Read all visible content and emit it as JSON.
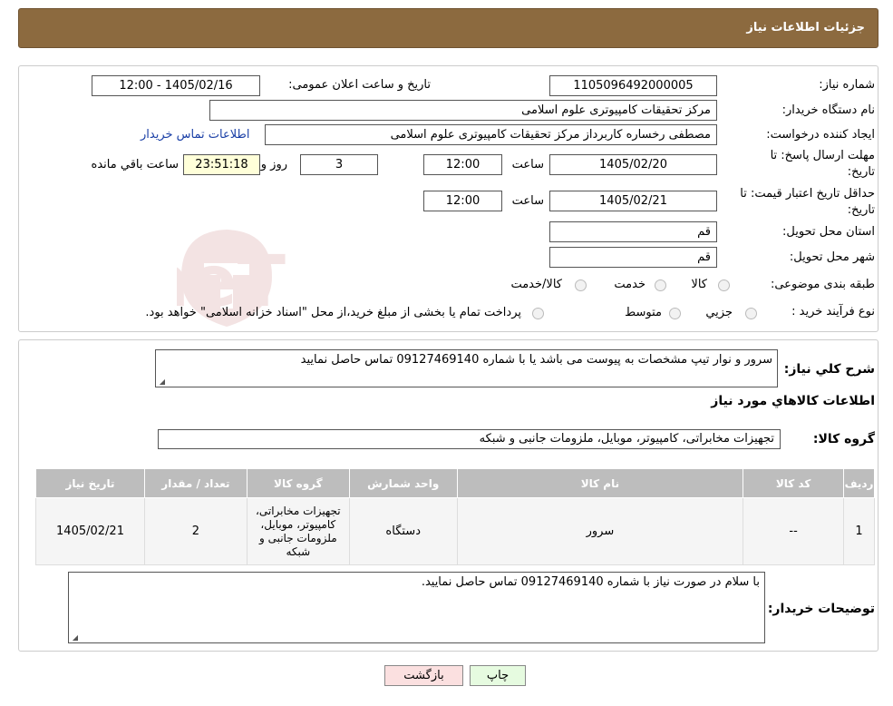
{
  "header": {
    "title": "جزئیات اطلاعات نیاز"
  },
  "fields": {
    "need_number_label": "شماره نیاز:",
    "need_number": "1105096492000005",
    "announce_label": "تاریخ و ساعت اعلان عمومی:",
    "announce_value": "1405/02/16 - 12:00",
    "buyer_org_label": "نام دستگاه خریدار:",
    "buyer_org": "مرکز تحقیقات کامپیوتری علوم اسلامی",
    "requester_label": "ایجاد کننده درخواست:",
    "requester": "مصطفی رخساره کاربرداز مرکز تحقیقات کامپیوتری علوم اسلامی",
    "contact_link": "اطلاعات تماس خریدار",
    "deadline_label_1": "مهلت ارسال پاسخ: تا",
    "deadline_label_2": "تاریخ:",
    "deadline_date": "1405/02/20",
    "time_label": "ساعت",
    "deadline_time": "12:00",
    "days": "3",
    "days_label": "روز و",
    "remaining": "23:51:18",
    "remaining_label": "ساعت باقي مانده",
    "validity_label_1": "حداقل تاریخ اعتبار قیمت: تا",
    "validity_label_2": "تاریخ:",
    "validity_date": "1405/02/21",
    "validity_time": "12:00",
    "province_label": "استان محل تحویل:",
    "province": "قم",
    "city_label": "شهر محل تحویل:",
    "city": "قم",
    "category_label": "طبقه بندی موضوعی:",
    "category_options": [
      "کالا",
      "خدمت",
      "کالا/خدمت"
    ],
    "process_label": "نوع فرآیند خرید :",
    "process_options": [
      "جزیي",
      "متوسط"
    ],
    "process_note": "پرداخت تمام یا بخشی از مبلغ خرید،از محل \"اسناد خزانه اسلامی\" خواهد بود."
  },
  "description": {
    "label": "شرح کلي نياز:",
    "text": "سرور و نوار تیپ مشخصات به پیوست می باشد یا با شماره 09127469140 تماس حاصل نمایید"
  },
  "goods": {
    "section_title": "اطلاعات کالاهاي مورد نياز",
    "group_label": "گروه کالا:",
    "group_value": "تجهیزات مخابراتی، کامپیوتر، موبایل، ملزومات جانبی و شبکه",
    "columns": [
      "رديف",
      "کد کالا",
      "نام کالا",
      "واحد شمارش",
      "گروه کالا",
      "تعداد / مقدار",
      "تاريخ نياز"
    ],
    "row": {
      "index": "1",
      "code": "--",
      "name": "سرور",
      "unit": "دستگاه",
      "group": "تجهیزات مخابراتی، کامپیوتر، موبایل، ملزومات جانبی و شبکه",
      "qty": "2",
      "date": "1405/02/21"
    }
  },
  "buyer_notes": {
    "label": "توضیحات خریدار:",
    "text": "با سلام در صورت نیاز با شماره 09127469140 تماس حاصل نمایید."
  },
  "buttons": {
    "print": "چاپ",
    "back": "بازگشت"
  },
  "watermark": {
    "text": "AriaTender.neT"
  }
}
